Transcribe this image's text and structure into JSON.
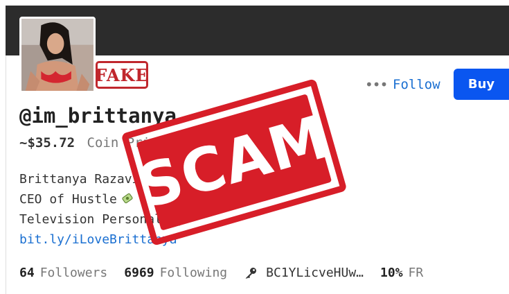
{
  "profile": {
    "fake_label": "FAKE",
    "username": "@im_brittanya",
    "price": "~$35.72",
    "price_label": "Coin Price",
    "bio_lines": [
      "Brittanya Razavi",
      "CEO of Hustle",
      "Television Personality"
    ],
    "bio_link": "bit.ly/iLoveBrittanya"
  },
  "actions": {
    "more_label": "•••",
    "follow_label": "Follow",
    "buy_label": "Buy"
  },
  "stats": {
    "followers_count": "64",
    "followers_label": "Followers",
    "following_count": "6969",
    "following_label": "Following",
    "address": "BC1YLicveHUw…",
    "reward_percent": "10%",
    "reward_label": "FR"
  },
  "overlay": {
    "scam_label": "SCAM"
  },
  "icons": {
    "more": "more-dots-icon",
    "key": "key-icon",
    "emoji": "money-emoji-icon"
  },
  "colors": {
    "banner": "#2c2c2c",
    "accent": "#1a6fd1",
    "buy": "#0a56f0",
    "stamp": "#d71e28"
  }
}
